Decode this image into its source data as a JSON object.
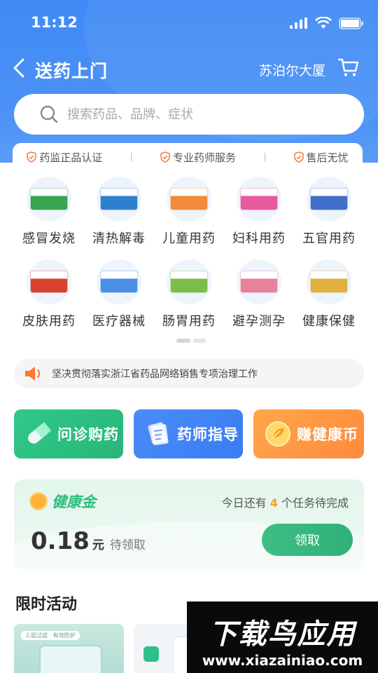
{
  "status_bar": {
    "time": "11:12"
  },
  "nav": {
    "title": "送药上门",
    "location": "苏泊尔大厦"
  },
  "search": {
    "placeholder": "搜索药品、品牌、症状"
  },
  "trust": [
    "药监正品认证",
    "专业药师服务",
    "售后无忧"
  ],
  "categories": [
    {
      "label": "感冒发烧",
      "icon": "cold-fever-medicine-icon",
      "color": "#3aa44f"
    },
    {
      "label": "清热解毒",
      "icon": "detox-medicine-icon",
      "color": "#2f7fd1"
    },
    {
      "label": "儿童用药",
      "icon": "children-medicine-icon",
      "color": "#f28a3a"
    },
    {
      "label": "妇科用药",
      "icon": "gynecology-medicine-icon",
      "color": "#e85aa0"
    },
    {
      "label": "五官用药",
      "icon": "ent-medicine-icon",
      "color": "#3f6fc8"
    },
    {
      "label": "皮肤用药",
      "icon": "skin-medicine-icon",
      "color": "#d8412e"
    },
    {
      "label": "医疗器械",
      "icon": "medical-device-icon",
      "color": "#4a90e2"
    },
    {
      "label": "肠胃用药",
      "icon": "stomach-medicine-icon",
      "color": "#7bbd4a"
    },
    {
      "label": "避孕测孕",
      "icon": "pregnancy-test-icon",
      "color": "#e8829c"
    },
    {
      "label": "健康保健",
      "icon": "health-supplement-icon",
      "color": "#e0b040"
    }
  ],
  "notice": {
    "text": "坚决贯彻落实浙江省药品网络销售专项治理工作"
  },
  "quick_actions": [
    {
      "label": "问诊购药",
      "icon": "pill-icon"
    },
    {
      "label": "药师指导",
      "icon": "document-icon"
    },
    {
      "label": "赚健康币",
      "icon": "coin-icon"
    }
  ],
  "health_gold": {
    "name": "健康金",
    "task_prefix": "今日还有",
    "task_count": "4",
    "task_suffix": "个任务待完成",
    "amount": "0.18",
    "unit": "元",
    "status": "待领取",
    "button": "领取"
  },
  "section_title": "限时活动",
  "promo_tag": "三层过滤 · 有效防护",
  "watermark": {
    "title": "下载鸟应用",
    "url": "www.xiazainiao.com"
  },
  "colors": {
    "primary": "#3f8af5",
    "green": "#2eb178",
    "orange": "#ff8a3d"
  }
}
